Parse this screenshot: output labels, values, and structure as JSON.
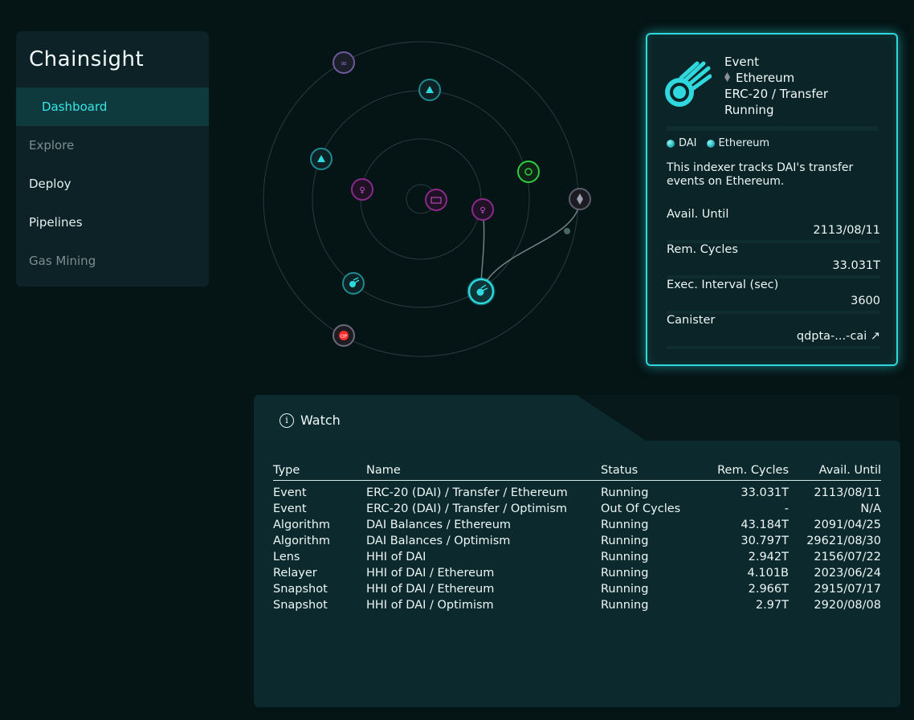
{
  "app": {
    "title": "Chainsight"
  },
  "sidebar": {
    "items": [
      {
        "label": "Dashboard",
        "state": "active"
      },
      {
        "label": "Explore",
        "state": "dim"
      },
      {
        "label": "Deploy",
        "state": "normal"
      },
      {
        "label": "Pipelines",
        "state": "normal"
      },
      {
        "label": "Gas Mining",
        "state": "dim"
      }
    ]
  },
  "graph": {
    "nodes": [
      {
        "icon": "polygon-icon",
        "color": "#9b6bd6"
      },
      {
        "icon": "snapshot-icon",
        "color": "#2fd8dc"
      },
      {
        "icon": "snapshot-icon",
        "color": "#2fd8dc"
      },
      {
        "icon": "algorithm-icon",
        "color": "#c040c0"
      },
      {
        "icon": "lens-icon",
        "color": "#c040c0"
      },
      {
        "icon": "algorithm-icon",
        "color": "#c040c0"
      },
      {
        "icon": "relayer-icon",
        "color": "#2ecc40"
      },
      {
        "icon": "ethereum-icon",
        "color": "#888899"
      },
      {
        "icon": "event-icon",
        "color": "#2fd8dc"
      },
      {
        "icon": "event-icon",
        "color": "#2fd8dc"
      },
      {
        "icon": "optimism-icon",
        "color": "#e0e0e0"
      }
    ]
  },
  "detail": {
    "type": "Event",
    "chain": "Ethereum",
    "label": "ERC-20 / Transfer",
    "status": "Running",
    "chips": [
      "DAI",
      "Ethereum"
    ],
    "description": "This indexer tracks DAI's transfer events on Ethereum.",
    "fields": [
      {
        "key": "Avail. Until",
        "value": "2113/08/11"
      },
      {
        "key": "Rem. Cycles",
        "value": "33.031T"
      },
      {
        "key": "Exec. Interval (sec)",
        "value": "3600"
      },
      {
        "key": "Canister",
        "value": "qdpta-...-cai ↗"
      }
    ]
  },
  "watch": {
    "title": "Watch",
    "columns": [
      "Type",
      "Name",
      "Status",
      "Rem. Cycles",
      "Avail. Until"
    ],
    "rows": [
      [
        "Event",
        "ERC-20 (DAI) / Transfer / Ethereum",
        "Running",
        "33.031T",
        "2113/08/11"
      ],
      [
        "Event",
        "ERC-20 (DAI) / Transfer / Optimism",
        "Out Of Cycles",
        "-",
        "N/A"
      ],
      [
        "Algorithm",
        "DAI Balances / Ethereum",
        "Running",
        "43.184T",
        "2091/04/25"
      ],
      [
        "Algorithm",
        "DAI Balances / Optimism",
        "Running",
        "30.797T",
        "29621/08/30"
      ],
      [
        "Lens",
        "HHI of DAI",
        "Running",
        "2.942T",
        "2156/07/22"
      ],
      [
        "Relayer",
        "HHI of DAI / Ethereum",
        "Running",
        "4.101B",
        "2023/06/24"
      ],
      [
        "Snapshot",
        "HHI of DAI / Ethereum",
        "Running",
        "2.966T",
        "2915/07/17"
      ],
      [
        "Snapshot",
        "HHI of DAI / Optimism",
        "Running",
        "2.97T",
        "2920/08/08"
      ]
    ]
  }
}
